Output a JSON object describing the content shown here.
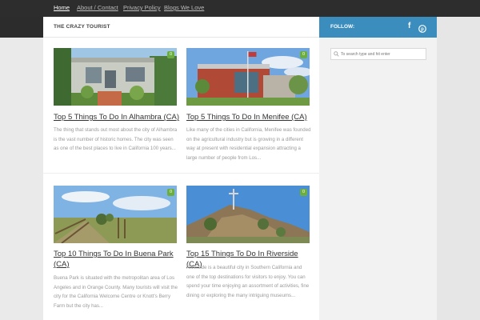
{
  "nav": {
    "items": [
      {
        "label": "Home",
        "active": true
      },
      {
        "label": "About / Contact"
      },
      {
        "label": "Privacy Policy"
      },
      {
        "label": "Blogs We Love"
      }
    ]
  },
  "header": {
    "site_title": "THE CRAZY TOURIST"
  },
  "sidebar": {
    "follow_label": "FOLLOW:",
    "social": [
      {
        "icon": "facebook-icon",
        "glyph": "f"
      },
      {
        "icon": "pinterest-icon",
        "glyph": "P"
      }
    ],
    "search_placeholder": "To search type and hit enter"
  },
  "posts": [
    {
      "title": "Top 5 Things To Do In Alhambra (CA)",
      "excerpt": "The thing that stands out most about the city of Alhambra is the vast number of historic homes. The city was seen as one of the best places to live in California 100 years...",
      "comments": "0"
    },
    {
      "title": "Top 5 Things To Do In Menifee (CA)",
      "excerpt": "Like many of the cities in California, Menifee was founded on the agricultural industry but is growing in a different way at present with residential expansion attracting a large number of people from Los...",
      "comments": "0"
    },
    {
      "title": "Top 10 Things To Do In Buena Park (CA)",
      "excerpt": "Buena Park is situated with the metropolitan area of Los Angeles and in Orange County. Many tourists will visit the city for the California Welcome Centre or Knott's Berry Farm but the city has...",
      "comments": "0"
    },
    {
      "title": "Top 15 Things To Do In Riverside (CA)",
      "excerpt": "Riverside is a beautiful city in Southern California and one of the top destinations for visitors to enjoy. You can spend your time enjoying an assortment of activities, fine dining or exploring the many intriguing museums...",
      "comments": "0"
    }
  ]
}
